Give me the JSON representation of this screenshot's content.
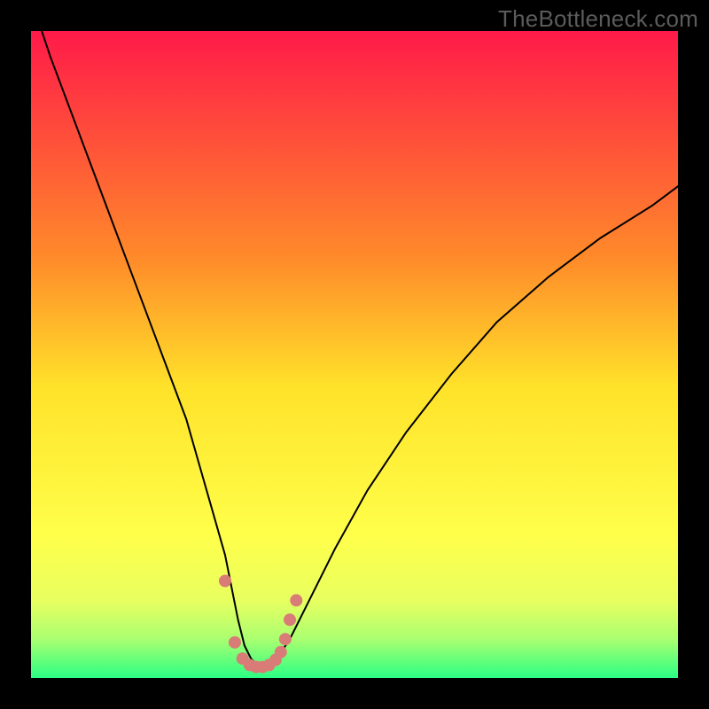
{
  "watermark": "TheBottleneck.com",
  "chart_data": {
    "type": "line",
    "title": "",
    "xlabel": "",
    "ylabel": "",
    "xlim": [
      0,
      100
    ],
    "ylim": [
      0,
      100
    ],
    "grid": false,
    "gradient_stops": [
      {
        "offset": 0,
        "color": "#ff1a49"
      },
      {
        "offset": 35,
        "color": "#ff8a2a"
      },
      {
        "offset": 55,
        "color": "#ffe22a"
      },
      {
        "offset": 78,
        "color": "#ffff4a"
      },
      {
        "offset": 88,
        "color": "#e8ff60"
      },
      {
        "offset": 94,
        "color": "#aaff70"
      },
      {
        "offset": 100,
        "color": "#2bff84"
      }
    ],
    "series": [
      {
        "name": "bottleneck-curve",
        "color": "#000000",
        "stroke_width": 2,
        "x": [
          0,
          3,
          6,
          9,
          12,
          15,
          18,
          21,
          24,
          26,
          28,
          30,
          31,
          32,
          33,
          34,
          35,
          36,
          38,
          40,
          43,
          47,
          52,
          58,
          65,
          72,
          80,
          88,
          96,
          100
        ],
        "y": [
          105,
          96,
          88,
          80,
          72,
          64,
          56,
          48,
          40,
          33,
          26,
          19,
          14,
          9,
          5,
          3,
          2,
          2,
          3,
          6,
          12,
          20,
          29,
          38,
          47,
          55,
          62,
          68,
          73,
          76
        ]
      },
      {
        "name": "highlight-dots",
        "color": "#d97b77",
        "marker": "circle",
        "marker_size": 7,
        "x": [
          30.0,
          31.5,
          32.7,
          33.8,
          34.8,
          35.8,
          36.8,
          37.8,
          38.6,
          39.3,
          40.0,
          41.0
        ],
        "y": [
          15.0,
          5.5,
          3.0,
          2.0,
          1.7,
          1.7,
          2.0,
          2.8,
          4.0,
          6.0,
          9.0,
          12.0
        ]
      }
    ]
  }
}
